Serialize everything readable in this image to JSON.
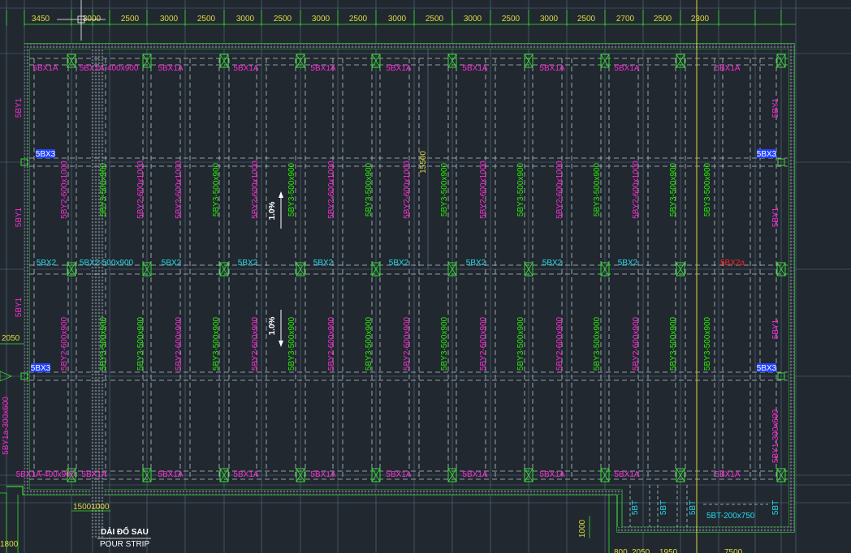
{
  "colors": {
    "background": "#212830",
    "grid": "#5a6f86",
    "outline": "#35e02e",
    "beam_dash": "#b8c2cc",
    "dim_text": "#dcdc3c",
    "magenta": "#ff2bd6",
    "green": "#26f000",
    "cyan": "#27d8e8",
    "blue": "#2042ff",
    "red": "#ff2020",
    "white": "#ffffff",
    "yellow_line": "#d8d840"
  },
  "top_dimensions": [
    "3450",
    "3000",
    "2500",
    "3000",
    "2500",
    "3000",
    "2500",
    "3000",
    "2500",
    "3000",
    "2500",
    "3000",
    "2500",
    "3000",
    "2500",
    "2700",
    "2500",
    "2300"
  ],
  "top_beam_labels": [
    "5BX1A",
    "5BX1A-400x900",
    "5BX1A",
    "5BX1A",
    "5BX1A",
    "5BX1A",
    "5BX1A",
    "5BX1A",
    "5BX1A",
    "5BX1A"
  ],
  "bottom_beam_labels": [
    "5BX1A-400x900",
    "5BX1A",
    "5BX1A",
    "5BX1A",
    "5BX1A",
    "5BX1A",
    "5BX1A",
    "5BX1A",
    "5BX1A",
    "5BX1A"
  ],
  "mid_beam_labels": [
    "5BX2",
    "5BX2-500x900",
    "5BX2",
    "5BX2",
    "5BX2",
    "5BX2",
    "5BX2",
    "5BX2",
    "5BX2"
  ],
  "mid_beam_red_label": "5BX2a",
  "blue_tags": [
    "5BX3",
    "5BX3",
    "5BX3",
    "5BX3"
  ],
  "vertical_labels_upper": [
    "5BY2-600x1000",
    "5BY3-500x900",
    "5BY2-600x1000",
    "5BY2-600x1000",
    "5BY3-500x900",
    "5BY2-600x1000",
    "5BY3-500x900",
    "5BY2-600x1000",
    "5BY3-500x900",
    "5BY2-600x1000",
    "5BY3-500x900",
    "5BY2-600x1000",
    "5BY3-500x900",
    "5BY2-600x1000",
    "5BY3-500x900",
    "5BY2-600x1000",
    "5BY3-500x900",
    "5BY3-500x900"
  ],
  "vertical_labels_lower": [
    "5BY2-600x900",
    "5BY3-500x900",
    "5BY3-500x900",
    "5BY2-600x900",
    "5BY3-500x900",
    "5BY2-600x900",
    "5BY3-500x900",
    "5BY2-600x900",
    "5BY3-500x900",
    "5BY2-600x900",
    "5BY3-500x900",
    "5BY2-600x900",
    "5BY3-500x900",
    "5BY2-600x900",
    "5BY3-500x900",
    "5BY2-600x900",
    "5BY3-500x900",
    "5BY3-500x900"
  ],
  "edge_labels": {
    "left_1": "5BY1",
    "left_2": "5BY1",
    "left_3": "5BY1",
    "left_long": "5BY1a-300x600",
    "right_1": "5BY1",
    "right_2": "5BY1",
    "right_3": "5BY1",
    "right_long": "5BY1-300x600"
  },
  "slope_labels": [
    "1.0%",
    "1.0%"
  ],
  "dim_15500": "15500",
  "dim_2050": "2050",
  "dim_1500_1000": "15001000",
  "dim_1000": "1000",
  "dim_1800": "1800",
  "bottom_5bt": [
    "5BT",
    "5BT",
    "5BT",
    "5BT"
  ],
  "bottom_5bt_long": "5BT-200x750",
  "pour_strip_vi": "DẢI ĐỔ SAU",
  "pour_strip_en": "POUR STRIP",
  "bottom_dims": [
    "800",
    "2050",
    "1950",
    "7500"
  ]
}
